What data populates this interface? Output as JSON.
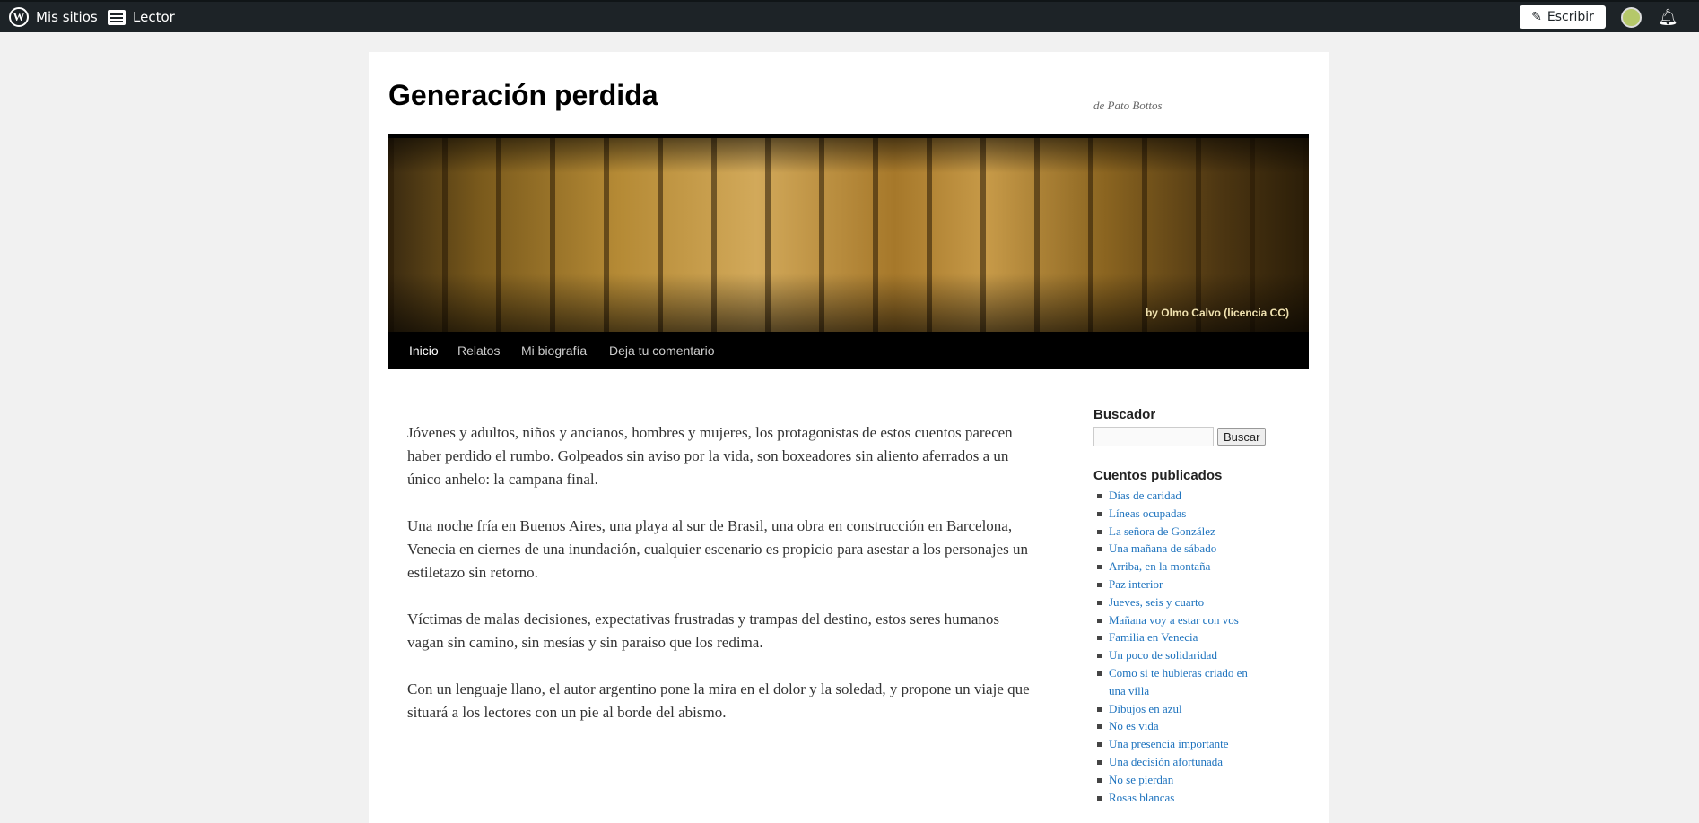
{
  "adminbar": {
    "my_sites": "Mis sitios",
    "reader": "Lector",
    "write": "Escribir"
  },
  "site": {
    "title": "Generación perdida",
    "description": "de Pato Bottos",
    "header_credit": "by Olmo Calvo (licencia CC)"
  },
  "menu": [
    "Inicio",
    "Relatos",
    "Mi biografía",
    "Deja tu comentario"
  ],
  "content": {
    "paragraphs": [
      "Jóvenes y adultos, niños y ancianos, hombres y mujeres, los protagonistas de estos cuentos parecen haber perdido el rumbo. Golpeados sin aviso por la vida, son boxeadores sin aliento aferrados a un único anhelo: la campana final.",
      "Una noche fría en Buenos Aires, una playa al sur de Brasil, una obra en construcción en Barcelona, Venecia en ciernes de una inundación, cualquier escenario es propicio para asestar a los personajes un estiletazo sin retorno.",
      "Víctimas de malas decisiones, expectativas frustradas y trampas del destino, estos seres humanos vagan sin camino, sin mesías y sin paraíso que los redima.",
      "Con un lenguaje llano, el autor argentino pone la mira en el dolor y la soledad, y propone un viaje que situará a los lectores con un pie al borde del abismo."
    ]
  },
  "sidebar": {
    "search_title": "Buscador",
    "search_button": "Buscar",
    "stories_title": "Cuentos publicados",
    "stories": [
      "Días de caridad",
      "Líneas ocupadas",
      "La señora de González",
      "Una mañana de sábado",
      "Arriba, en la montaña",
      "Paz interior",
      "Jueves, seis y cuarto",
      "Mañana voy a estar con vos",
      "Familia en Venecia",
      "Un poco de solidaridad",
      "Como si te hubieras criado en una villa",
      "Dibujos en azul",
      "No es vida",
      "Una presencia importante",
      "Una decisión afortunada",
      "No se pierdan",
      "Rosas blancas"
    ]
  },
  "colors": {
    "adminbar_bg": "#1d2327",
    "link": "#1e73be",
    "menu_bg": "#000000"
  }
}
